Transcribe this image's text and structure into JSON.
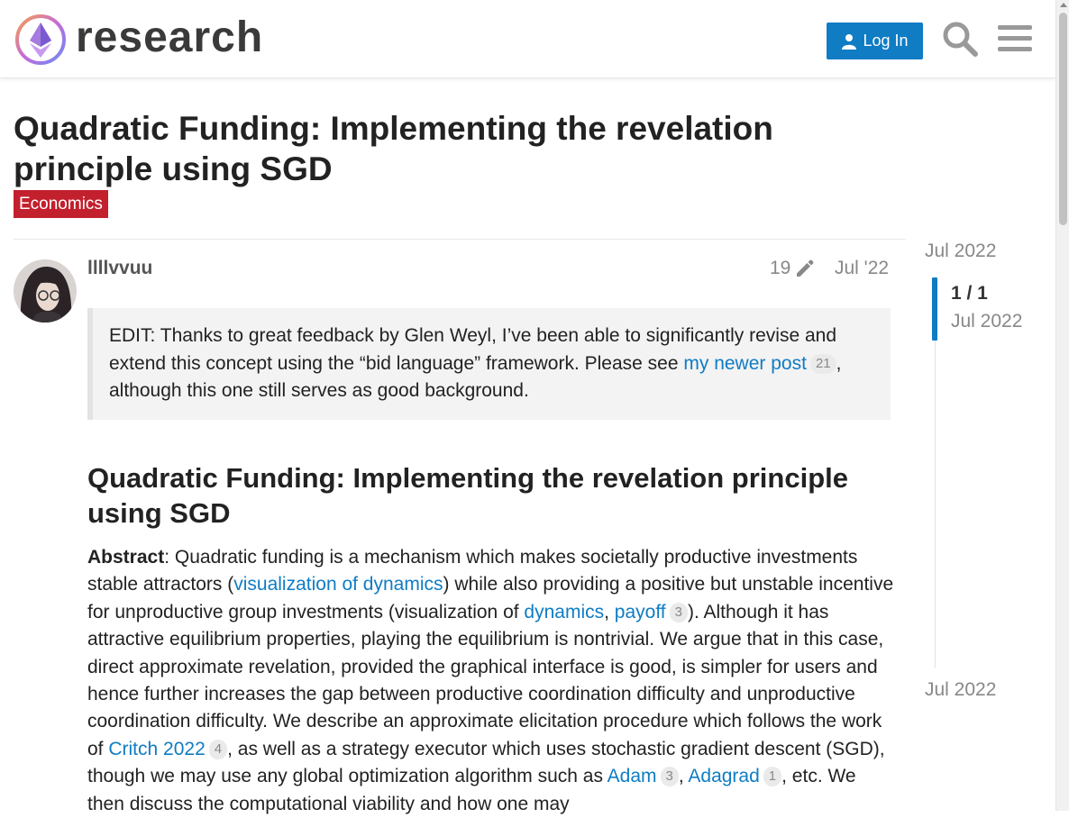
{
  "header": {
    "site_name": "research",
    "login_label": "Log In"
  },
  "topic": {
    "title": "Quadratic Funding: Implementing the revelation principle using SGD",
    "category": "Economics",
    "category_color": "#c3202e"
  },
  "post": {
    "username": "llllvvuu",
    "edit_count": "19",
    "date": "Jul '22",
    "quote": {
      "text_before": "EDIT: Thanks to great feedback by Glen Weyl, I’ve been able to significantly revise and extend this concept using the “bid language” framework. Please see ",
      "link_text": "my newer post",
      "link_count": "21",
      "text_after": ", although this one still serves as good background."
    },
    "heading": "Quadratic Funding: Implementing the revelation principle using SGD",
    "abstract": {
      "label": "Abstract",
      "p1": ": Quadratic funding is a mechanism which makes societally productive investments stable attractors (",
      "link1": "visualization of dynamics",
      "p2": ") while also providing a positive but unstable incentive for unproductive group investments (visualization of ",
      "link2": "dynamics",
      "p3": ", ",
      "link3": "payoff",
      "link3_count": "3",
      "p4": "). Although it has attractive equilibrium properties, playing the equilibrium is nontrivial. We argue that in this case, direct approximate revelation, provided the graphical interface is good, is simpler for users and hence further increases the gap between productive coordination difficulty and unproductive coordination difficulty. We describe an approximate elicitation procedure which follows the work of ",
      "link4": "Critch 2022",
      "link4_count": "4",
      "p5": ", as well as a strategy executor which uses stochastic gradient descent (SGD), though we may use any global optimization algorithm such as ",
      "link5": "Adam",
      "link5_count": "3",
      "p6": ", ",
      "link6": "Adagrad",
      "link6_count": "1",
      "p7": ", etc. We then discuss the computational viability and how one may"
    }
  },
  "timeline": {
    "start_date": "Jul 2022",
    "position": "1 / 1",
    "position_date": "Jul 2022",
    "end_date": "Jul 2022"
  },
  "colors": {
    "accent": "#0f7cc4",
    "category": "#c3202e"
  }
}
